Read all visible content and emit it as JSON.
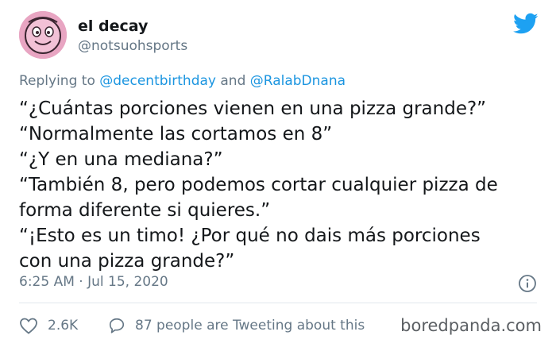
{
  "user": {
    "display_name": "el decay",
    "handle": "@notsuohsports"
  },
  "reply": {
    "prefix": "Replying to",
    "mention_1": "@decentbirthday",
    "conjunction": "and",
    "mention_2": "@RalabDnana"
  },
  "tweet": {
    "lines": [
      "“¿Cuántas porciones vienen en una pizza grande?”",
      "“Normalmente las cortamos en 8”",
      "“¿Y en una mediana?”",
      "“También 8, pero podemos cortar cualquier pizza de",
      "forma diferente si quieres.”",
      "“¡Esto es un timo! ¿Por qué no dais más porciones",
      "con una pizza grande?”"
    ]
  },
  "meta": {
    "timestamp": "6:25 AM · Jul 15, 2020"
  },
  "actions": {
    "likes": "2.6K",
    "conversation": "87 people are Tweeting about this"
  },
  "watermark": "boredpanda.com",
  "colors": {
    "twitter_blue": "#1da1f2",
    "mention_blue": "#1b95e0",
    "secondary_text": "#657786"
  },
  "icons": {
    "brand": "twitter-bird-icon",
    "info": "info-icon",
    "like": "heart-icon",
    "conversation": "speech-bubble-icon"
  }
}
